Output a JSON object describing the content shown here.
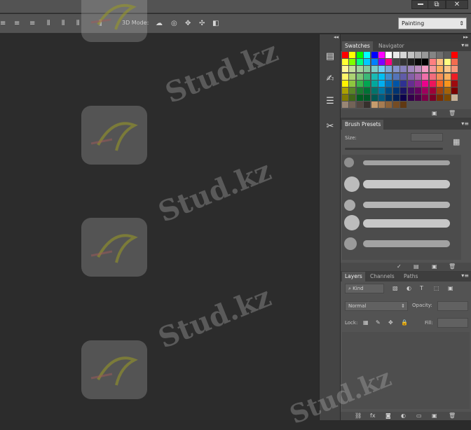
{
  "options_bar": {
    "mode_3d": "3D Mode:",
    "workspace": "Painting"
  },
  "window_buttons": {
    "restore": "⧉",
    "close": "✕"
  },
  "swatches": {
    "tabs": [
      "Swatches",
      "Navigator"
    ],
    "colors": [
      [
        "#ff0000",
        "#ffff00",
        "#00ff00",
        "#00ffff",
        "#0000ff",
        "#ff00ff",
        "#ffffff",
        "#ebebeb",
        "#d6d6d6",
        "#c2c2c2",
        "#adadad",
        "#999999",
        "#858585",
        "#707070",
        "#5c5c5c",
        "#ff0000"
      ],
      [
        "#ffff33",
        "#7fff00",
        "#00ff80",
        "#00c8ff",
        "#0080ff",
        "#8000ff",
        "#ff0080",
        "#474747",
        "#333333",
        "#1f1f1f",
        "#0a0a0a",
        "#000000",
        "#ff8080",
        "#ffbf80",
        "#ffff80",
        "#f26c4f"
      ],
      [
        "#fff799",
        "#c4df9b",
        "#a3d39c",
        "#82ca9d",
        "#7bcdc8",
        "#6ecff6",
        "#7ea7d8",
        "#8493ca",
        "#8781bd",
        "#a187be",
        "#bc8dbf",
        "#f49ac2",
        "#f6989d",
        "#fbaf5d",
        "#fdc689",
        "#f7977a"
      ],
      [
        "#fff568",
        "#acd373",
        "#7cc576",
        "#3bb878",
        "#1abbb4",
        "#00bff3",
        "#438ccb",
        "#5574b9",
        "#605ca8",
        "#8560a8",
        "#a763a9",
        "#f06ea9",
        "#f26d7d",
        "#f68e56",
        "#fbaf5d",
        "#ed1c24"
      ],
      [
        "#fff200",
        "#8dc63f",
        "#39b54a",
        "#00a651",
        "#00a99d",
        "#00aeef",
        "#0072bc",
        "#0054a6",
        "#2e3192",
        "#662d91",
        "#92278f",
        "#ec008c",
        "#ed145b",
        "#f26522",
        "#f7941d",
        "#9e0b0f"
      ],
      [
        "#aba000",
        "#598527",
        "#197b30",
        "#007236",
        "#00746b",
        "#0076a3",
        "#004a80",
        "#003471",
        "#1b1464",
        "#440e62",
        "#630460",
        "#9e005d",
        "#9e0039",
        "#a0410d",
        "#a36209",
        "#790000"
      ],
      [
        "#827b00",
        "#406618",
        "#005e20",
        "#005826",
        "#005952",
        "#005b7f",
        "#003663",
        "#002157",
        "#0d004c",
        "#32004b",
        "#4b0049",
        "#7b0046",
        "#7a0026",
        "#7b2e00",
        "#7d4900",
        "#c7b299"
      ],
      [
        "#998675",
        "#736357",
        "#534741",
        "#37302d",
        "#c69c6d",
        "#a67c52",
        "#8c6239",
        "#754c24",
        "#603913"
      ]
    ]
  },
  "brush_presets": {
    "tab": "Brush Presets",
    "size_label": "Size:"
  },
  "layers": {
    "tabs": [
      "Layers",
      "Channels",
      "Paths"
    ],
    "filter": "Kind",
    "blend_mode": "Normal",
    "opacity_label": "Opacity:",
    "lock_label": "Lock:",
    "fill_label": "Fill:"
  },
  "watermark": "Stud.kz"
}
